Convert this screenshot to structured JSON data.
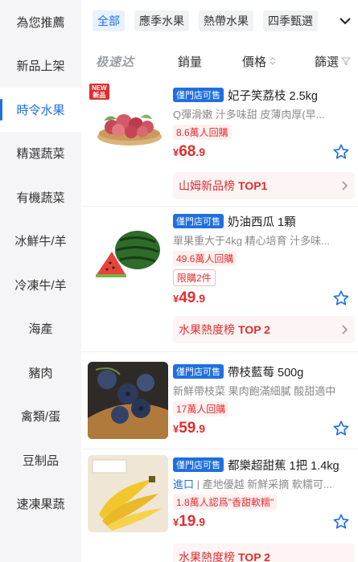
{
  "sidebar": {
    "items": [
      {
        "label": "為您推薦"
      },
      {
        "label": "新品上架"
      },
      {
        "label": "時令水果"
      },
      {
        "label": "精選蔬菜"
      },
      {
        "label": "有機蔬菜"
      },
      {
        "label": "冰鮮牛/羊"
      },
      {
        "label": "冷凍牛/羊"
      },
      {
        "label": "海產"
      },
      {
        "label": "豬肉"
      },
      {
        "label": "禽類/蛋"
      },
      {
        "label": "豆制品"
      },
      {
        "label": "速凍果蔬"
      }
    ],
    "active_index": 2
  },
  "tabs": [
    {
      "label": "全部"
    },
    {
      "label": "應季水果"
    },
    {
      "label": "熱帶水果"
    },
    {
      "label": "四季甄選"
    }
  ],
  "sortbar": {
    "logo": "极速达",
    "sales": "銷量",
    "price": "價格",
    "filter": "篩選"
  },
  "products": [
    {
      "badge": "僅門店可售",
      "title": "妃子笑荔枝 2.5kg",
      "desc": "Q彈滑嫩 汁多味甜 皮薄肉厚(早...",
      "pills": [
        "8.6萬人回購"
      ],
      "price_symbol": "¥",
      "price_int": "68",
      "price_dec": ".9",
      "rank_text": "山姆新品榜",
      "rank_top": "TOP1",
      "new_tag": "NEW\n新品"
    },
    {
      "badge": "僅門店可售",
      "title": "奶油西瓜 1顆",
      "desc": "單果重大于4kg 精心培育 汁多味...",
      "pills": [
        "49.6萬人回購"
      ],
      "limit": "限購2件",
      "price_symbol": "¥",
      "price_int": "49",
      "price_dec": ".9",
      "rank_text": "水果熱度榜",
      "rank_top": "TOP 2"
    },
    {
      "badge": "僅門店可售",
      "title": "帶枝藍莓 500g",
      "desc": "新鮮帶枝菜 果肉飽滿細膩 酸甜適中",
      "pills": [
        "17萬人回購"
      ],
      "price_symbol": "¥",
      "price_int": "59",
      "price_dec": ".9"
    },
    {
      "badge": "僅門店可售",
      "title": "都樂超甜蕉 1把 1.4kg",
      "origin": "進口",
      "desc": "產地優越 新鮮采摘 軟糯可...",
      "pills": [
        "1.8萬人認爲\"香甜軟糯\""
      ],
      "price_symbol": "¥",
      "price_int": "19",
      "price_dec": ".9",
      "rank_text": "水果熱度榜",
      "rank_top": "TOP 2"
    }
  ],
  "colors": {
    "accent": "#1f6fe0",
    "price": "#e02e2e",
    "sidebar_bg": "#f5f5f7"
  }
}
